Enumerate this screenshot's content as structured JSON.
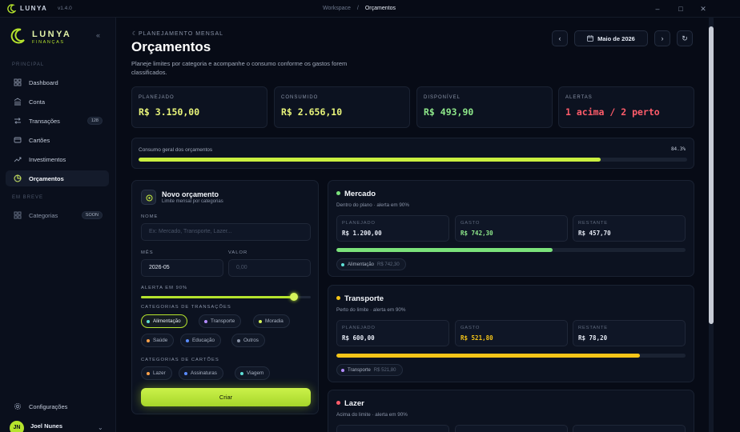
{
  "titlebar": {
    "brand": "LUNYA",
    "version": "v1.4.0",
    "crumb_workspace": "Workspace",
    "crumb_sep": "/",
    "crumb_current": "Orçamentos"
  },
  "sidebar": {
    "brand": "LUNYA",
    "brand_sub": "FINANÇAS",
    "section_main": "PRINCIPAL",
    "section_soon": "EM BREVE",
    "items": [
      {
        "label": "Dashboard",
        "icon": "dashboard-icon"
      },
      {
        "label": "Conta",
        "icon": "bank-icon"
      },
      {
        "label": "Transações",
        "icon": "transfer-icon",
        "badge": "128"
      },
      {
        "label": "Cartões",
        "icon": "card-icon"
      },
      {
        "label": "Investimentos",
        "icon": "trend-icon"
      },
      {
        "label": "Orçamentos",
        "icon": "pie-icon",
        "active": true
      }
    ],
    "soon_items": [
      {
        "label": "Categorias",
        "icon": "grid-icon",
        "badge": "SOON"
      }
    ],
    "settings": "Configurações",
    "user": {
      "initials": "JN",
      "name": "Joel Nunes"
    }
  },
  "header": {
    "eyebrow": "PLANEJAMENTO MENSAL",
    "title": "Orçamentos",
    "description": "Planeje limites por categoria e acompanhe o consumo conforme os gastos forem classificados.",
    "month": "Maio de 2026"
  },
  "stats": [
    {
      "label": "PLANEJADO",
      "value": "R$ 3.150,00",
      "color": "#e9f57a"
    },
    {
      "label": "CONSUMIDO",
      "value": "R$ 2.656,10",
      "color": "#e9f57a"
    },
    {
      "label": "DISPONÍVEL",
      "value": "R$ 493,90",
      "color": "#8ee88a"
    },
    {
      "label": "ALERTAS",
      "value": "1 acima / 2 perto",
      "color": "#ff5c6a"
    }
  ],
  "overall": {
    "label": "Consumo geral dos orçamentos",
    "percent_text": "84.3%",
    "percent": 84.3
  },
  "form": {
    "title": "Novo orçamento",
    "subtitle": "Limite mensal por categorias",
    "name_label": "NOME",
    "name_placeholder": "Ex: Mercado, Transporte, Lazer...",
    "month_label": "MÊS",
    "month_value": "2026-05",
    "value_label": "VALOR",
    "value_placeholder": "0,00",
    "alert_label": "ALERTA EM 90%",
    "alert_value": 0.9,
    "tx_categories_label": "CATEGORIAS DE TRANSAÇÕES",
    "tx_categories": [
      {
        "label": "Alimentação",
        "color": "#5fe0d6",
        "selected": true
      },
      {
        "label": "Transporte",
        "color": "#b48cff",
        "selected": false
      },
      {
        "label": "Moradia",
        "color": "#d6f55a",
        "selected": false
      },
      {
        "label": "Saúde",
        "color": "#ffa24a",
        "selected": false
      },
      {
        "label": "Educação",
        "color": "#5a8cff",
        "selected": false
      },
      {
        "label": "Outros",
        "color": "#8a94a8",
        "selected": false
      }
    ],
    "card_categories_label": "CATEGORIAS DE CARTÕES",
    "card_categories": [
      {
        "label": "Lazer",
        "color": "#ffa24a"
      },
      {
        "label": "Assinaturas",
        "color": "#5a8cff"
      },
      {
        "label": "Viagem",
        "color": "#5fe0d6"
      }
    ],
    "submit": "Criar"
  },
  "budgets": [
    {
      "name": "Mercado",
      "dot": "#7be27b",
      "status": "Dentro do plano · alerta em 90%",
      "planned_label": "PLANEJADO",
      "planned": "R$ 1.200,00",
      "spent_label": "GASTO",
      "spent": "R$ 742,30",
      "spent_color": "#8ee88a",
      "left_label": "RESTANTE",
      "left": "R$ 457,70",
      "progress": 0.62,
      "bar": "#7be27b",
      "tag": "Alimentação",
      "tag_amount": "R$ 742,30",
      "tag_color": "#5fe0d6"
    },
    {
      "name": "Transporte",
      "dot": "#f5c518",
      "status": "Perto do limite · alerta em 90%",
      "planned_label": "PLANEJADO",
      "planned": "R$ 600,00",
      "spent_label": "GASTO",
      "spent": "R$ 521,80",
      "spent_color": "#f5c518",
      "left_label": "RESTANTE",
      "left": "R$ 78,20",
      "progress": 0.87,
      "bar": "#f5c518",
      "tag": "Transporte",
      "tag_amount": "R$ 521,80",
      "tag_color": "#b48cff"
    },
    {
      "name": "Lazer",
      "dot": "#ff5c6a",
      "status": "Acima do limite · alerta em 90%"
    }
  ]
}
